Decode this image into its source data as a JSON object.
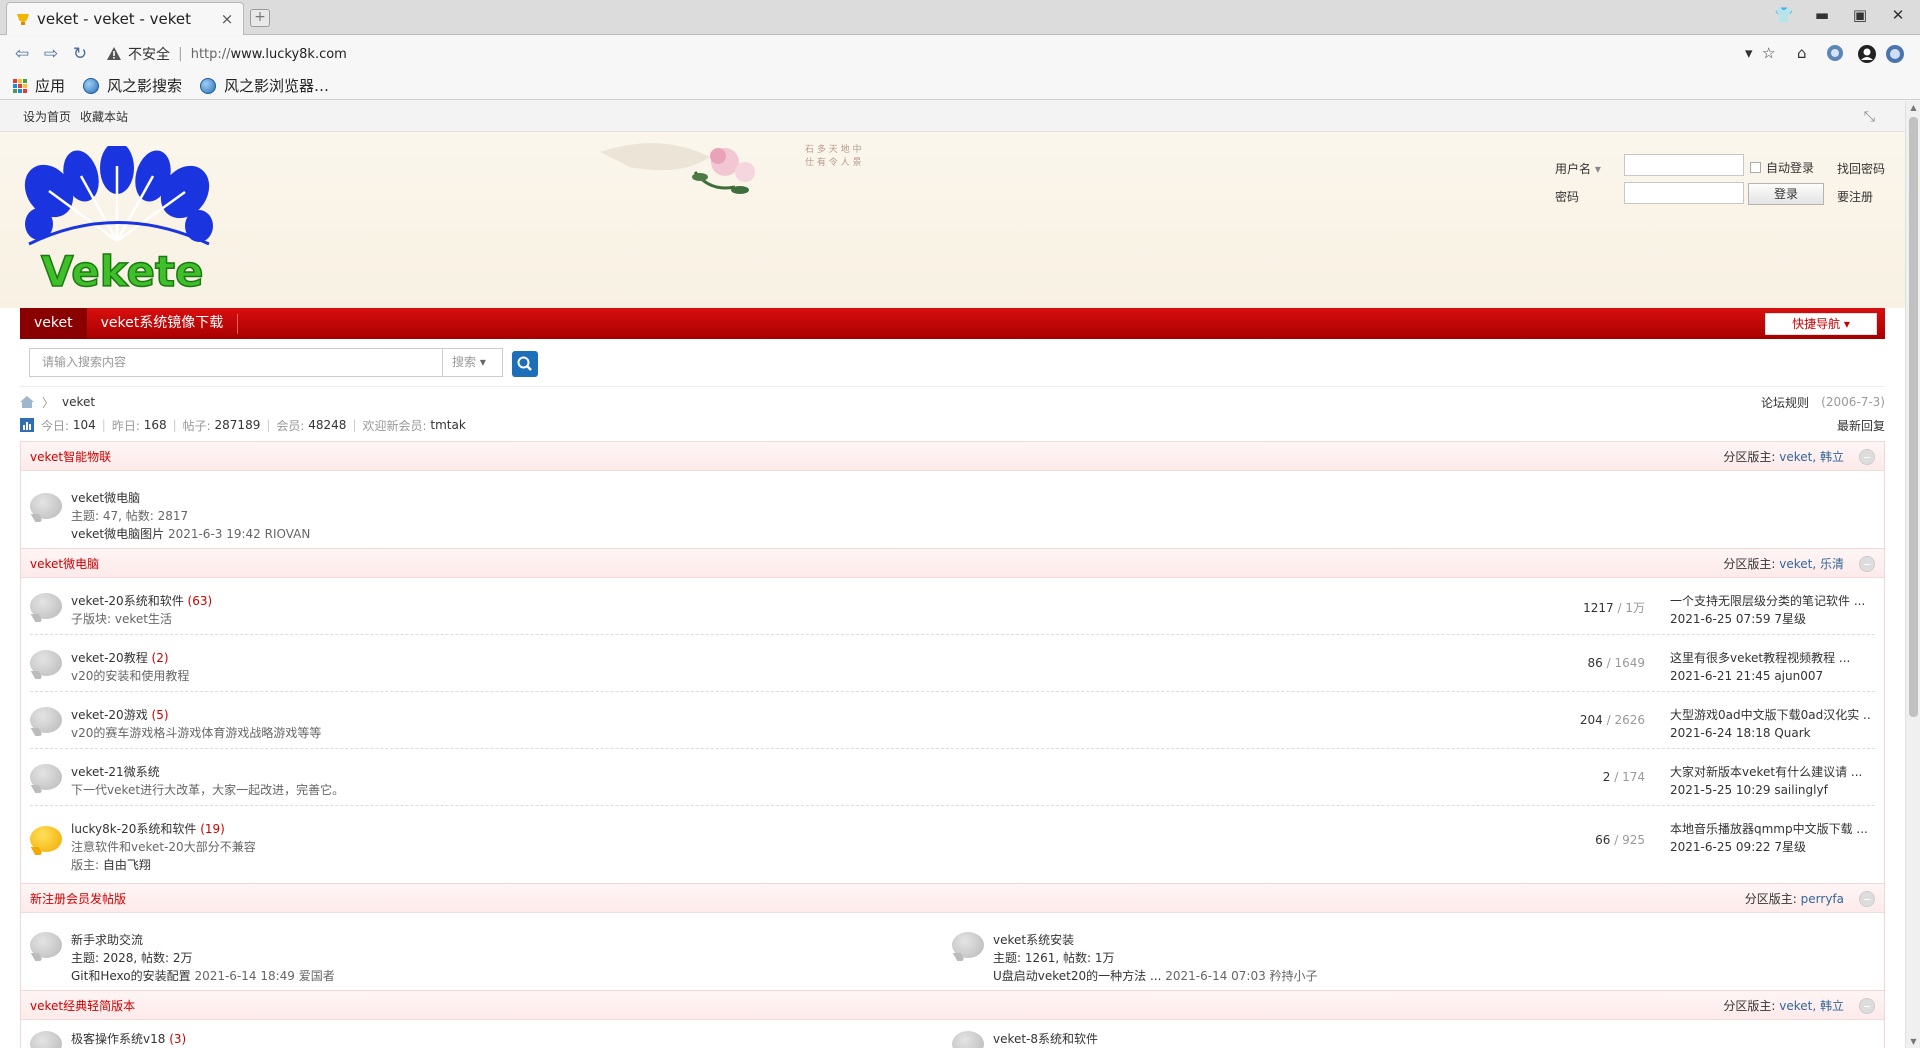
{
  "browser": {
    "tab_title": "veket - veket - veket",
    "tab_close": "×",
    "new_tab": "+",
    "insecure_label": "不安全",
    "url_prefix": "http://",
    "url_host": "www.lucky8k.com",
    "bookmarks": [
      {
        "label": "应用",
        "icon": "apps-grid-icon"
      },
      {
        "label": "风之影搜索",
        "icon": "globe-icon"
      },
      {
        "label": "风之影浏览器…",
        "icon": "globe-icon"
      }
    ],
    "icons": {
      "back": "⇦",
      "forward": "⇨",
      "reload": "↻",
      "dropdown": "▾",
      "star": "☆",
      "home": "⌂",
      "minimize": "▬",
      "maximize": "▣",
      "close": "✕",
      "shirt": "👕"
    }
  },
  "topbar": {
    "set_home": "设为首页",
    "favorite": "收藏本站",
    "collapse": "⤡"
  },
  "logo": {
    "text": "Vekete"
  },
  "login": {
    "username_label": "用户名",
    "auto_login": "自动登录",
    "find_password": "找回密码",
    "password_label": "密码",
    "login_button": "登录",
    "register": "要注册"
  },
  "nav": {
    "items": [
      {
        "label": "veket",
        "active": true
      },
      {
        "label": "veket系统镜像下载",
        "active": false
      }
    ],
    "quick_nav": "快捷导航 ▾"
  },
  "search": {
    "placeholder": "请输入搜索内容",
    "type": "搜索",
    "type_arrow": "▾"
  },
  "breadcrumb": {
    "current": "veket",
    "arrow": "〉",
    "rules": "论坛规则",
    "rules_date": "(2006-7-3)"
  },
  "stats": {
    "today_label": "今日:",
    "today": "104",
    "yesterday_label": "昨日:",
    "yesterday": "168",
    "posts_label": "帖子:",
    "posts": "287189",
    "members_label": "会员:",
    "members": "48248",
    "newest_label": "欢迎新会员:",
    "newest": "tmtak",
    "latest_reply": "最新回复"
  },
  "groups": [
    {
      "name": "veket智能物联",
      "mods_label": "分区版主:",
      "mods": "veket, 韩立",
      "forums": [
        {
          "name": "veket微电脑",
          "line2": "主题: 47, 帖数: 2817",
          "line3": "veket微电脑图片",
          "line3_meta": "2021-6-3 19:42 RIOVAN"
        }
      ]
    },
    {
      "name": "veket微电脑",
      "mods_label": "分区版主:",
      "mods": "veket, 乐清",
      "forums": [
        {
          "name": "veket-20系统和软件",
          "today": "(63)",
          "desc": "子版块: veket生活",
          "threads": "1217",
          "posts": "/ 1万",
          "last_subject": "一个支持无限层级分类的笔记软件 ...",
          "last_meta": "2021-6-25 07:59 7星级",
          "new": false
        },
        {
          "name": "veket-20教程",
          "today": "(2)",
          "desc": "v20的安装和使用教程",
          "threads": "86",
          "posts": "/ 1649",
          "last_subject": "这里有很多veket教程视频教程 ...",
          "last_meta": "2021-6-21 21:45 ajun007",
          "new": false
        },
        {
          "name": "veket-20游戏",
          "today": "(5)",
          "desc": "v20的赛车游戏格斗游戏体育游戏战略游戏等等",
          "threads": "204",
          "posts": "/ 2626",
          "last_subject": "大型游戏0ad中文版下载0ad汉化实 ...",
          "last_meta": "2021-6-24 18:18 Quark",
          "new": false
        },
        {
          "name": "veket-21微系统",
          "today": "",
          "desc": "下一代veket进行大改革，大家一起改进，完善它。",
          "threads": "2",
          "posts": "/ 174",
          "last_subject": "大家对新版本veket有什么建议请 ...",
          "last_meta": "2021-5-25 10:29 sailinglyf",
          "new": false
        },
        {
          "name": "lucky8k-20系统和软件",
          "today": "(19)",
          "desc": "注意软件和veket-20大部分不兼容",
          "moderator_label": "版主:",
          "moderator": "自由飞翔",
          "threads": "66",
          "posts": "/ 925",
          "last_subject": "本地音乐播放器qmmp中文版下载 ...",
          "last_meta": "2021-6-25 09:22 7星级",
          "new": true
        }
      ]
    },
    {
      "name": "新注册会员发帖版",
      "mods_label": "分区版主:",
      "mods": "perryfa",
      "forums": [
        {
          "name": "新手求助交流",
          "line2": "主题: 2028, 帖数: 2万",
          "line3": "Git和Hexo的安装配置",
          "line3_meta": "2021-6-14 18:49 爱国者"
        },
        {
          "name": "veket系统安装",
          "line2": "主题: 1261, 帖数: 1万",
          "line3": "U盘启动veket20的一种方法 ...",
          "line3_meta": "2021-6-14 07:03 矜持小子"
        }
      ]
    },
    {
      "name": "veket经典轻简版本",
      "mods_label": "分区版主:",
      "mods": "veket, 韩立",
      "forums": [
        {
          "name": "极客操作系统v18",
          "today": "(3)"
        },
        {
          "name": "veket-8系统和软件",
          "today": ""
        }
      ]
    }
  ]
}
